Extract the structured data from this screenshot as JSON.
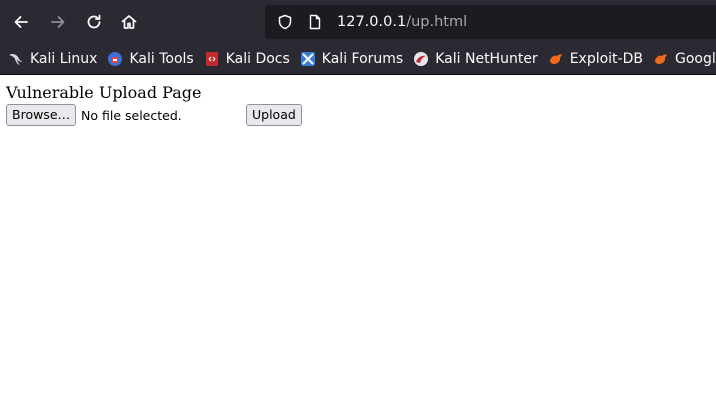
{
  "browser": {
    "url_host": "127.0.0.1",
    "url_path": "/up.html",
    "bookmarks": [
      {
        "label": "Kali Linux",
        "icon": "kali-dragon-icon"
      },
      {
        "label": "Kali Tools",
        "icon": "kali-tools-icon"
      },
      {
        "label": "Kali Docs",
        "icon": "kali-docs-icon"
      },
      {
        "label": "Kali Forums",
        "icon": "kali-forums-icon"
      },
      {
        "label": "Kali NetHunter",
        "icon": "kali-nethunter-icon"
      },
      {
        "label": "Exploit-DB",
        "icon": "exploit-db-icon"
      },
      {
        "label": "Google Hacking DB",
        "icon": "google-hacking-db-icon"
      }
    ]
  },
  "page": {
    "title": "Vulnerable Upload Page",
    "browse_label": "Browse…",
    "file_status": "No file selected.",
    "upload_label": "Upload"
  },
  "colors": {
    "chrome_bg": "#2b2a33",
    "urlbar_bg": "#1c1b22",
    "button_bg": "#e9e9ed"
  }
}
